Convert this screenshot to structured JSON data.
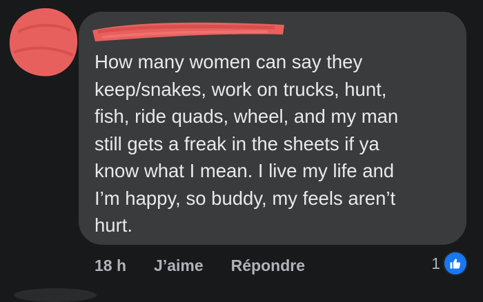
{
  "comment": {
    "text": "How many women can say they\nkeep/snakes, work on trucks, hunt,\nfish, ride quads, wheel, and my man\nstill gets a freak in the sheets if ya\nknow what I mean. I live my life and\nI’m happy, so buddy, my feels aren’t\nhurt."
  },
  "actions": {
    "time": "18 h",
    "like_label": "J’aime",
    "reply_label": "Répondre"
  },
  "reactions": {
    "count": "1",
    "icon": "thumbs-up-icon"
  },
  "colors": {
    "background": "#18191a",
    "bubble": "#3a3b3c",
    "redaction": "#e8605e",
    "like_blue": "#1877f2"
  }
}
